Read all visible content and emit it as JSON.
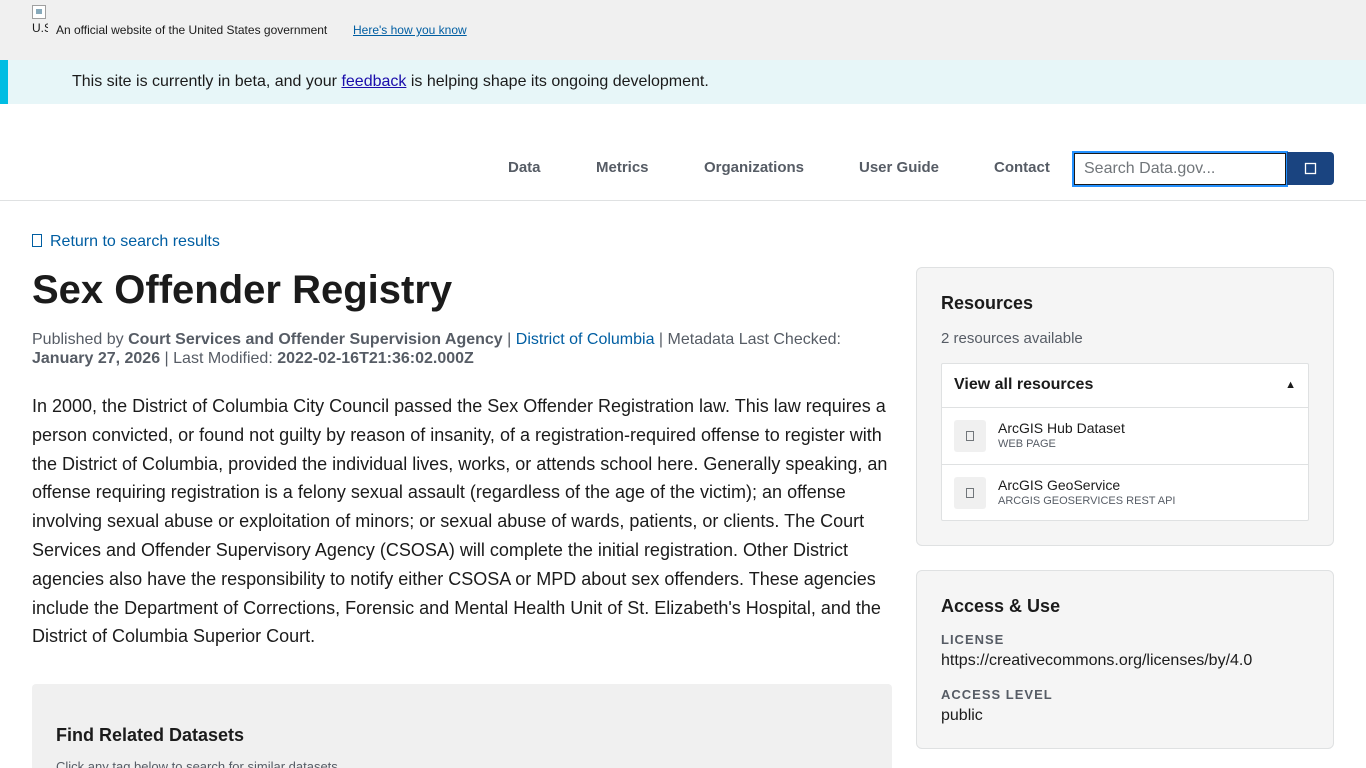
{
  "gov_banner": {
    "flag_alt": "U.S. flag",
    "text": "An official website of the United States government",
    "link": "Here's how you know"
  },
  "beta": {
    "before": "This site is currently in beta, and your ",
    "link": "feedback",
    "after": " is helping shape its ongoing development."
  },
  "nav": {
    "items": [
      "Data",
      "Metrics",
      "Organizations",
      "User Guide",
      "Contact"
    ],
    "search_placeholder": "Search Data.gov...",
    "search_icon": "search-icon"
  },
  "return_link": "Return to search results",
  "dataset": {
    "title": "Sex Offender Registry",
    "published_by_label": "Published by",
    "publisher": "Court Services and Offender Supervision Agency",
    "sep1": "|",
    "organization": "District of Columbia",
    "sep2": "|",
    "metadata_checked_label": "Metadata Last Checked:",
    "metadata_checked": "January 27, 2026",
    "sep3": "|",
    "last_modified_label": "Last Modified:",
    "last_modified": "2022-02-16T21:36:02.000Z",
    "description": "In 2000, the District of Columbia City Council passed the Sex Offender Registration law. This law requires a person convicted, or found not guilty by reason of insanity, of a registration-required offense to register with the District of Columbia, provided the individual lives, works, or attends school here. Generally speaking, an offense requiring registration is a felony sexual assault (regardless of the age of the victim); an offense involving sexual abuse or exploitation of minors; or sexual abuse of wards, patients, or clients. The Court Services and Offender Supervisory Agency (CSOSA) will complete the initial registration. Other District agencies also have the responsibility to notify either CSOSA or MPD about sex offenders. These agencies include the Department of Corrections, Forensic and Mental Health Unit of St. Elizabeth's Hospital, and the District of Columbia Superior Court."
  },
  "related": {
    "title": "Find Related Datasets",
    "hint": "Click any tag below to search for similar datasets"
  },
  "resources": {
    "title": "Resources",
    "count": "2 resources available",
    "toggle_label": "View all resources",
    "toggle_caret": "▲",
    "items": [
      {
        "name": "ArcGIS Hub Dataset",
        "type": "WEB PAGE"
      },
      {
        "name": "ArcGIS GeoService",
        "type": "ARCGIS GEOSERVICES REST API"
      }
    ]
  },
  "access": {
    "title": "Access & Use",
    "license_label": "LICENSE",
    "license": "https://creativecommons.org/licenses/by/4.0",
    "level_label": "ACCESS LEVEL",
    "level": "public"
  },
  "colors": {
    "primary_link": "#005ea2",
    "search_button": "#1a4480",
    "beta_accent": "#00bde3",
    "beta_bg": "#e7f6f8"
  }
}
